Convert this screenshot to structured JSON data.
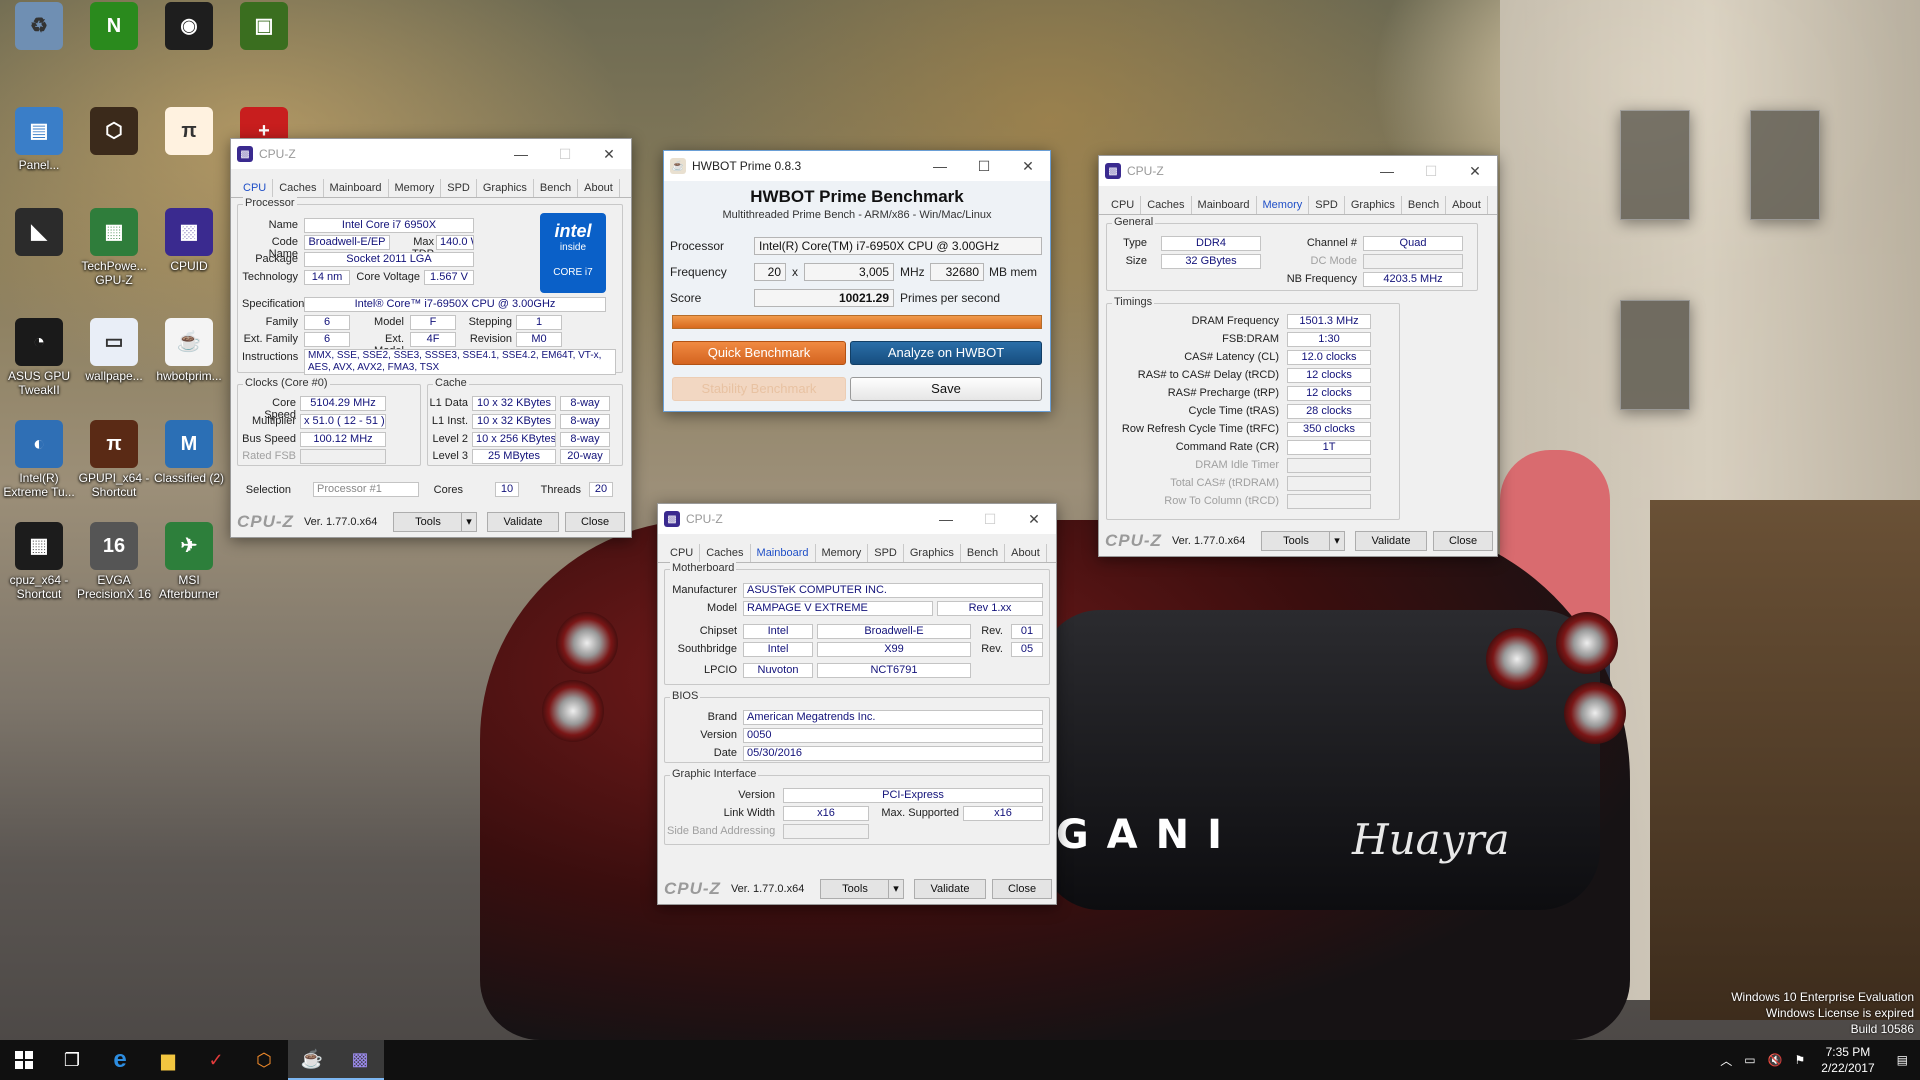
{
  "desktop": {
    "icons": [
      {
        "label": "",
        "icon": "recycle-bin-icon",
        "color": "#6f8fb3",
        "glyph": "♻"
      },
      {
        "label": "",
        "icon": "nvidia-icon",
        "color": "#2a8a1d",
        "glyph": "N"
      },
      {
        "label": "",
        "icon": "hwinfo-icon",
        "color": "#1e1e1e",
        "glyph": "◉"
      },
      {
        "label": "",
        "icon": "gpu-card-icon",
        "color": "#3a6e1f",
        "glyph": "▣"
      },
      {
        "label": "Panel...",
        "icon": "control-panel-icon",
        "color": "#3a7ec8",
        "glyph": "▤"
      },
      {
        "label": "",
        "icon": "orange-app-icon",
        "color": "#3b2a1b",
        "glyph": "⬡"
      },
      {
        "label": "",
        "icon": "superpi-icon",
        "color": "#fff2e0",
        "glyph": "π"
      },
      {
        "label": "",
        "icon": "aida-icon",
        "color": "#c81e1e",
        "glyph": "+"
      },
      {
        "label": "",
        "icon": "blade-icon",
        "color": "#2b2b2b",
        "glyph": "◣"
      },
      {
        "label": "TechPowe... GPU-Z",
        "icon": "gpuz-icon",
        "color": "#2f7d3b",
        "glyph": "▦"
      },
      {
        "label": "CPUID",
        "icon": "cpuid-icon",
        "color": "#3a2a8f",
        "glyph": "▩"
      },
      {
        "label": "ASUS GPU TweakII",
        "icon": "asus-gpu-tweak-icon",
        "color": "#1a1a1a",
        "glyph": "◔"
      },
      {
        "label": "wallpape...",
        "icon": "image-file-icon",
        "color": "#e9eef7",
        "glyph": "▭"
      },
      {
        "label": "hwbotprim...",
        "icon": "java-icon",
        "color": "#f4f4f4",
        "glyph": "☕"
      },
      {
        "label": "Intel(R) Extreme Tu...",
        "icon": "intel-xtu-icon",
        "color": "#2f6fb5",
        "glyph": "◐"
      },
      {
        "label": "GPUPI_x64 - Shortcut",
        "icon": "gpupi-icon",
        "color": "#5a2a15",
        "glyph": "π"
      },
      {
        "label": "Classified (2)",
        "icon": "classified-icon",
        "color": "#2b6fb5",
        "glyph": "M"
      },
      {
        "label": "cpuz_x64 - Shortcut",
        "icon": "cpuz-icon",
        "color": "#1c1c1c",
        "glyph": "▦"
      },
      {
        "label": "EVGA PrecisionX 16",
        "icon": "evga-icon",
        "color": "#555",
        "glyph": "16"
      },
      {
        "label": "MSI Afterburner",
        "icon": "msi-afterburner-icon",
        "color": "#2d7f3b",
        "glyph": "✈"
      }
    ],
    "watermark": [
      "Windows 10 Enterprise Evaluation",
      "Windows License is expired",
      "Build 10586"
    ]
  },
  "cpuz_common": {
    "app_title": "CPU-Z",
    "tabs": [
      "CPU",
      "Caches",
      "Mainboard",
      "Memory",
      "SPD",
      "Graphics",
      "Bench",
      "About"
    ],
    "brand": "CPU-Z",
    "version": "Ver. 1.77.0.x64",
    "tools_label": "Tools",
    "validate_label": "Validate",
    "close_label": "Close"
  },
  "cpu_tab": {
    "processor_group": "Processor",
    "name_l": "Name",
    "name": "Intel Core i7 6950X",
    "codename_l": "Code Name",
    "codename": "Broadwell-E/EP",
    "maxtdp_l": "Max TDP",
    "maxtdp": "140.0 W",
    "package_l": "Package",
    "package": "Socket 2011 LGA",
    "tech_l": "Technology",
    "tech": "14 nm",
    "corev_l": "Core Voltage",
    "corev": "1.567 V",
    "spec_l": "Specification",
    "spec": "Intel® Core™ i7-6950X CPU @ 3.00GHz",
    "family_l": "Family",
    "family": "6",
    "model_l": "Model",
    "model": "F",
    "stepping_l": "Stepping",
    "stepping": "1",
    "extfamily_l": "Ext. Family",
    "extfamily": "6",
    "extmodel_l": "Ext. Model",
    "extmodel": "4F",
    "revision_l": "Revision",
    "revision": "M0",
    "instr_l": "Instructions",
    "instr": "MMX, SSE, SSE2, SSE3, SSSE3, SSE4.1, SSE4.2, EM64T, VT-x, AES, AVX, AVX2, FMA3, TSX",
    "intel_logo": [
      "intel",
      "inside",
      "CORE i7"
    ],
    "clocks_group": "Clocks (Core #0)",
    "corespeed_l": "Core Speed",
    "corespeed": "5104.29 MHz",
    "mult_l": "Multiplier",
    "mult": "x 51.0 ( 12 - 51 )",
    "bus_l": "Bus Speed",
    "bus": "100.12 MHz",
    "fsb_l": "Rated FSB",
    "fsb": "",
    "cache_group": "Cache",
    "l1d_l": "L1 Data",
    "l1d": "10 x 32 KBytes",
    "l1d_w": "8-way",
    "l1i_l": "L1 Inst.",
    "l1i": "10 x 32 KBytes",
    "l1i_w": "8-way",
    "l2_l": "Level 2",
    "l2": "10 x 256 KBytes",
    "l2_w": "8-way",
    "l3_l": "Level 3",
    "l3": "25 MBytes",
    "l3_w": "20-way",
    "selection_l": "Selection",
    "selection": "Processor #1",
    "cores_l": "Cores",
    "cores": "10",
    "threads_l": "Threads",
    "threads": "20"
  },
  "hwbot": {
    "title": "HWBOT Prime 0.8.3",
    "heading": "HWBOT Prime Benchmark",
    "subheading": "Multithreaded Prime Bench - ARM/x86 - Win/Mac/Linux",
    "processor_l": "Processor",
    "processor": "Intel(R) Core(TM) i7-6950X CPU @ 3.00GHz",
    "freq_l": "Frequency",
    "freq_threads": "20",
    "x": "x",
    "freq_mhz": "3,005",
    "mhz": "MHz",
    "mem": "32680",
    "mem_unit": "MB mem",
    "score_l": "Score",
    "score": "10021.29",
    "score_unit": "Primes per second",
    "progress": 1.0,
    "quick_btn": "Quick Benchmark",
    "analyze_btn": "Analyze on HWBOT",
    "stability_btn": "Stability Benchmark",
    "save_btn": "Save"
  },
  "memory_tab": {
    "general_group": "General",
    "type_l": "Type",
    "type": "DDR4",
    "channel_l": "Channel #",
    "channel": "Quad",
    "size_l": "Size",
    "size": "32 GBytes",
    "dcmode_l": "DC Mode",
    "dcmode": "",
    "nbfreq_l": "NB Frequency",
    "nbfreq": "4203.5 MHz",
    "timings_group": "Timings",
    "rows": [
      {
        "l": "DRAM Frequency",
        "v": "1501.3 MHz",
        "dim": false
      },
      {
        "l": "FSB:DRAM",
        "v": "1:30",
        "dim": false
      },
      {
        "l": "CAS# Latency (CL)",
        "v": "12.0 clocks",
        "dim": false
      },
      {
        "l": "RAS# to CAS# Delay (tRCD)",
        "v": "12 clocks",
        "dim": false
      },
      {
        "l": "RAS# Precharge (tRP)",
        "v": "12 clocks",
        "dim": false
      },
      {
        "l": "Cycle Time (tRAS)",
        "v": "28 clocks",
        "dim": false
      },
      {
        "l": "Row Refresh Cycle Time (tRFC)",
        "v": "350 clocks",
        "dim": false
      },
      {
        "l": "Command Rate (CR)",
        "v": "1T",
        "dim": false
      },
      {
        "l": "DRAM Idle Timer",
        "v": "",
        "dim": true
      },
      {
        "l": "Total CAS# (tRDRAM)",
        "v": "",
        "dim": true
      },
      {
        "l": "Row To Column (tRCD)",
        "v": "",
        "dim": true
      }
    ]
  },
  "mainboard_tab": {
    "mb_group": "Motherboard",
    "manufacturer_l": "Manufacturer",
    "manufacturer": "ASUSTeK COMPUTER INC.",
    "model_l": "Model",
    "model": "RAMPAGE V EXTREME",
    "model_rev": "Rev 1.xx",
    "chipset_l": "Chipset",
    "chipset_vendor": "Intel",
    "chipset": "Broadwell-E",
    "rev_l": "Rev.",
    "chipset_rev": "01",
    "south_l": "Southbridge",
    "south_vendor": "Intel",
    "south": "X99",
    "south_rev": "05",
    "lpcio_l": "LPCIO",
    "lpcio_vendor": "Nuvoton",
    "lpcio": "NCT6791",
    "bios_group": "BIOS",
    "brand_l": "Brand",
    "brand": "American Megatrends Inc.",
    "version_l": "Version",
    "version": "0050",
    "date_l": "Date",
    "date": "05/30/2016",
    "gi_group": "Graphic Interface",
    "giver_l": "Version",
    "giver": "PCI-Express",
    "linkw_l": "Link Width",
    "linkw": "x16",
    "maxsup_l": "Max. Supported",
    "maxsup": "x16",
    "sideband_l": "Side Band Addressing",
    "sideband": ""
  },
  "taskbar": {
    "time": "7:35 PM",
    "date": "2/22/2017"
  }
}
